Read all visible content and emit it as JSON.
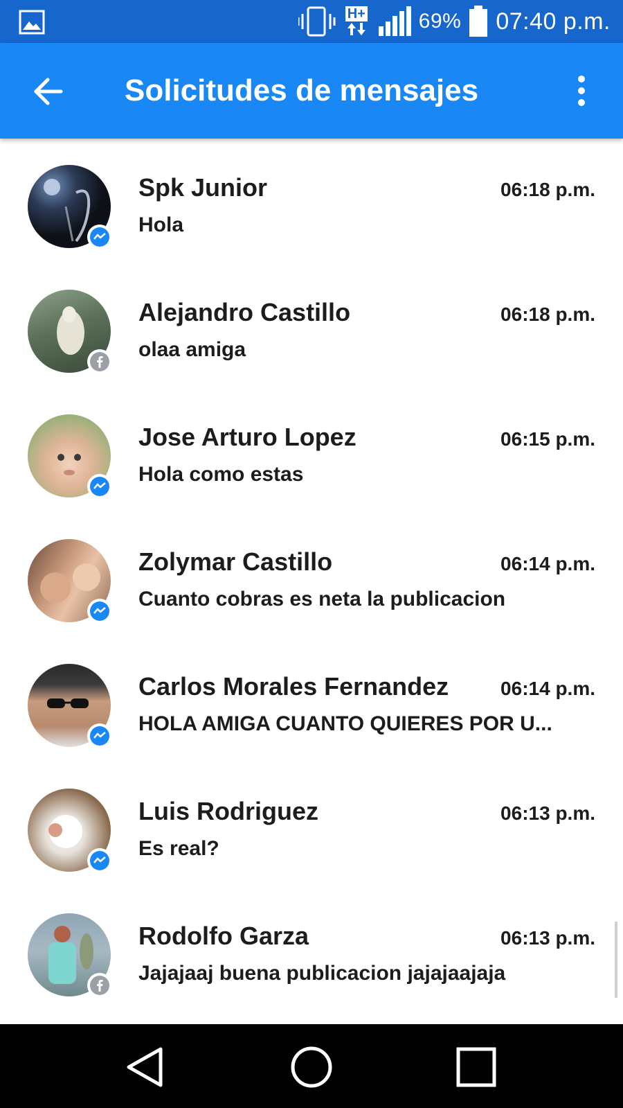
{
  "status_bar": {
    "battery_percent": "69%",
    "time": "07:40 p.m.",
    "network_type": "H+",
    "icons": [
      "image-icon",
      "vibrate-icon",
      "data-icon",
      "signal-icon",
      "battery-icon"
    ]
  },
  "app_bar": {
    "title": "Solicitudes de mensajes",
    "back_icon": "arrow-left-icon",
    "menu_icon": "more-vertical-icon"
  },
  "colors": {
    "status_bar": "#1666cc",
    "app_bar": "#1a88f4",
    "messenger_badge": "#1a88f4",
    "facebook_badge": "#9aa0a6",
    "text": "#1c1c1c"
  },
  "conversations": [
    {
      "name": "Spk Junior",
      "time": "06:18 p.m.",
      "message": "Hola",
      "badge": "messenger-icon"
    },
    {
      "name": "Alejandro Castillo",
      "time": "06:18 p.m.",
      "message": "olaa amiga",
      "badge": "facebook-icon"
    },
    {
      "name": "Jose Arturo Lopez",
      "time": "06:15 p.m.",
      "message": "Hola como estas",
      "badge": "messenger-icon"
    },
    {
      "name": "Zolymar Castillo",
      "time": "06:14 p.m.",
      "message": "Cuanto cobras es neta la publicacion",
      "badge": "messenger-icon"
    },
    {
      "name": "Carlos Morales Fernandez",
      "time": "06:14 p.m.",
      "message": "HOLA AMIGA CUANTO QUIERES POR U...",
      "badge": "messenger-icon"
    },
    {
      "name": "Luis Rodriguez",
      "time": "06:13 p.m.",
      "message": "Es real?",
      "badge": "messenger-icon"
    },
    {
      "name": "Rodolfo Garza",
      "time": "06:13 p.m.",
      "message": "Jajajaaj buena publicacion jajajaajaja",
      "badge": "facebook-icon"
    }
  ],
  "nav_bar": {
    "icons": [
      "back-triangle-icon",
      "home-circle-icon",
      "recents-square-icon"
    ]
  }
}
